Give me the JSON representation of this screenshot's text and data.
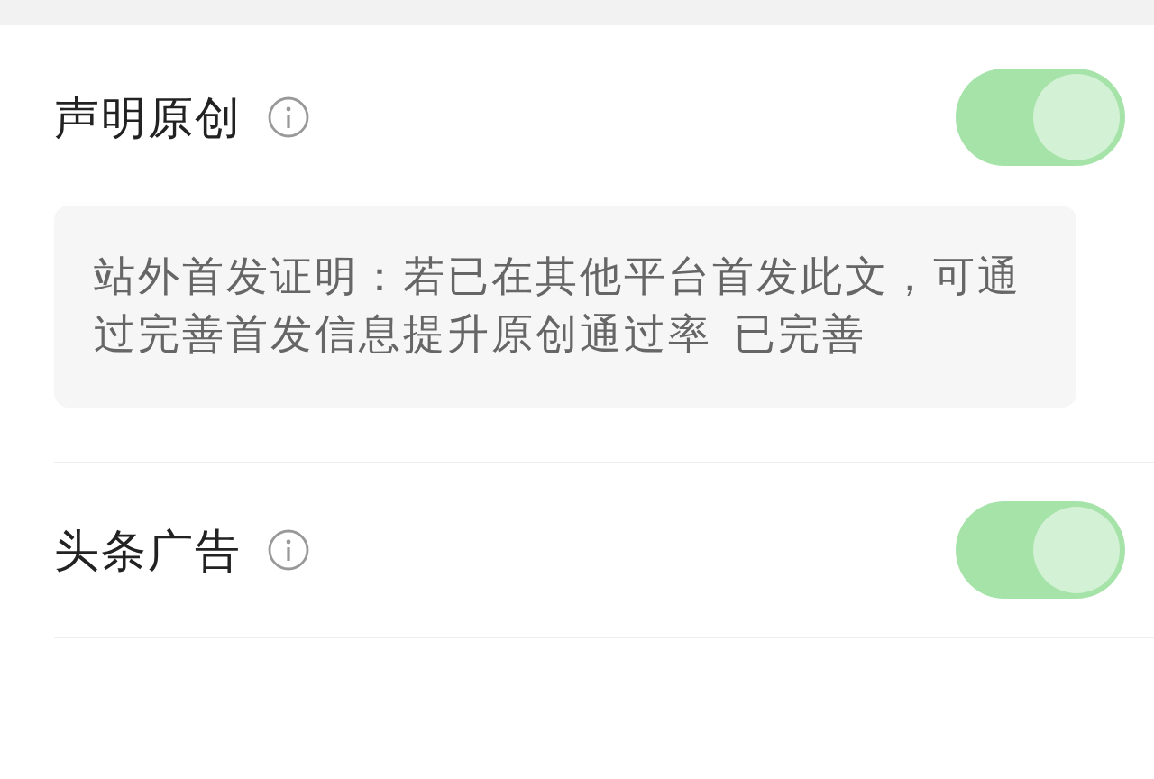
{
  "settings": [
    {
      "label": "声明原创",
      "on": true,
      "note": {
        "text": "站外首发证明：若已在其他平台首发此文，可通过完善首发信息提升原创通过率",
        "link": "已完善"
      }
    },
    {
      "label": "头条广告",
      "on": true
    }
  ]
}
